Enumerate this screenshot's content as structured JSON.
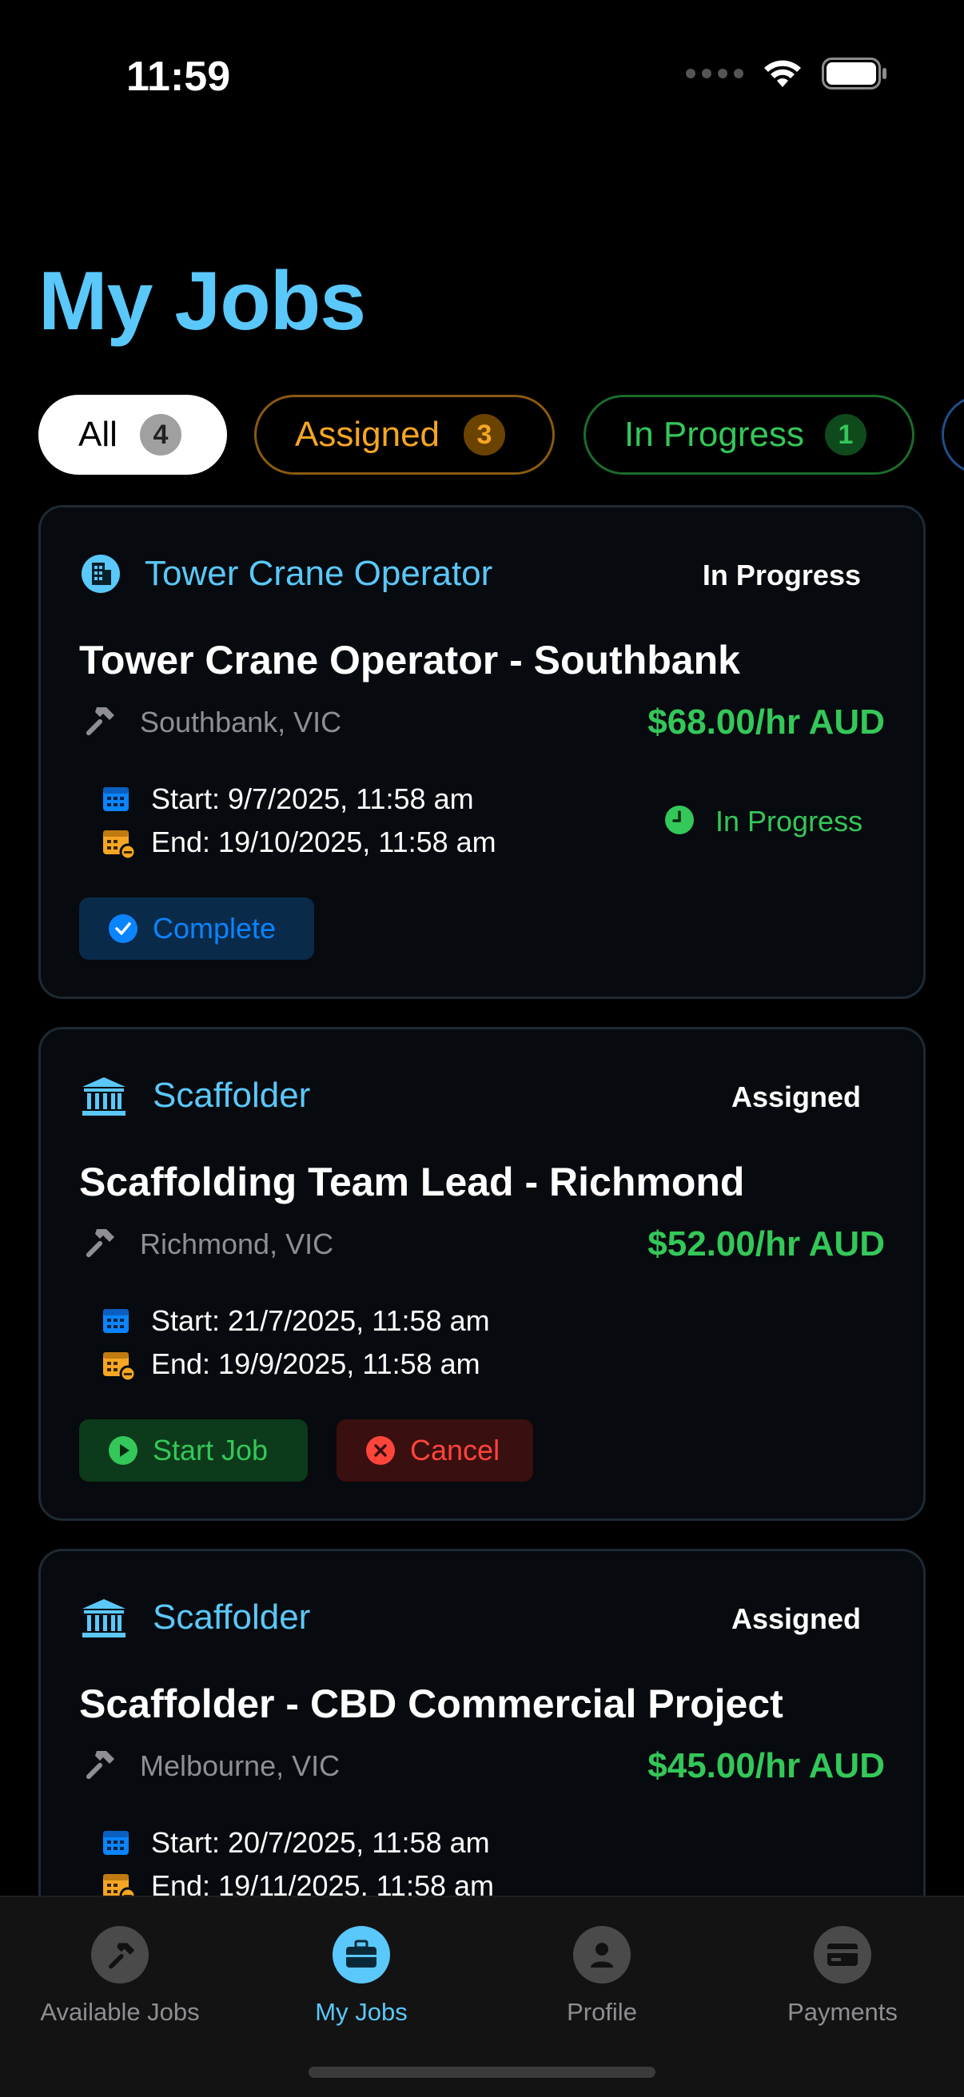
{
  "status_bar": {
    "time": "11:59"
  },
  "page": {
    "title": "My Jobs"
  },
  "filters": [
    {
      "label": "All",
      "count": "4"
    },
    {
      "label": "Assigned",
      "count": "3"
    },
    {
      "label": "In Progress",
      "count": "1"
    }
  ],
  "jobs": [
    {
      "category": "Tower Crane Operator",
      "status": "In Progress",
      "title": "Tower Crane Operator - Southbank",
      "location": "Southbank, VIC",
      "rate": "$68.00/hr AUD",
      "start": "Start: 9/7/2025, 11:58 am",
      "end": "End: 19/10/2025, 11:58 am",
      "progress_label": "In Progress",
      "actions": [
        "Complete"
      ]
    },
    {
      "category": "Scaffolder",
      "status": "Assigned",
      "title": "Scaffolding Team Lead - Richmond",
      "location": "Richmond, VIC",
      "rate": "$52.00/hr AUD",
      "start": "Start: 21/7/2025, 11:58 am",
      "end": "End: 19/9/2025, 11:58 am",
      "actions": [
        "Start Job",
        "Cancel"
      ]
    },
    {
      "category": "Scaffolder",
      "status": "Assigned",
      "title": "Scaffolder - CBD Commercial Project",
      "location": "Melbourne, VIC",
      "rate": "$45.00/hr AUD",
      "start": "Start: 20/7/2025, 11:58 am",
      "end": "End: 19/11/2025, 11:58 am"
    }
  ],
  "tabs": [
    {
      "label": "Available Jobs",
      "icon": "hammer-icon"
    },
    {
      "label": "My Jobs",
      "icon": "briefcase-icon",
      "active": true
    },
    {
      "label": "Profile",
      "icon": "person-icon"
    },
    {
      "label": "Payments",
      "icon": "card-icon"
    }
  ],
  "colors": {
    "accent": "#5ac8fa",
    "green": "#34c759",
    "orange": "#f5a623",
    "red": "#ff453a",
    "blue": "#0a84ff"
  }
}
